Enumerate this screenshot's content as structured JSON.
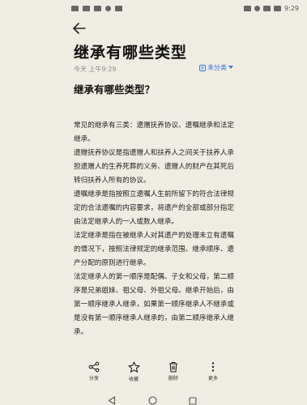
{
  "status_bar": {
    "time": "9:29"
  },
  "note": {
    "title": "继承有哪些类型",
    "meta": "今天 上午9:29",
    "category": "未分类",
    "heading": "继承有哪些类型？",
    "paragraphs": [
      "常见的继承有三类：遗赠抚养协议、遗嘱继承和法定继承。",
      "遗赠抚养协议是指遗赠人和扶养人之间关于扶养人承担遗赠人的生养死葬的义务、遗赠人的财产在其死后转归扶养人所有的协议。",
      "遗嘱继承是指按照立遗嘱人生前所留下的符合法律规定的合法遗嘱的内容要求，将遗产的全部或部分指定由法定继承人的一人或数人继承。",
      "法定继承是指在被继承人对其遗产的处理未立有遗嘱的情况下，按照法律规定的继承范围、继承顺序、遗产分配的原则进行继承。",
      "法定继承人的第一顺序是配偶、子女和父母，第二顺序是兄弟姐妹、祖父母、外祖父母。继承开始后，由第一顺序继承人继承，如果第一顺序继承人不继承或是没有第一顺序继承人继承的，由第二顺序继承人继承。"
    ]
  },
  "toolbar": {
    "share": "分享",
    "favorite": "收藏",
    "delete": "删除",
    "more": "更多"
  }
}
